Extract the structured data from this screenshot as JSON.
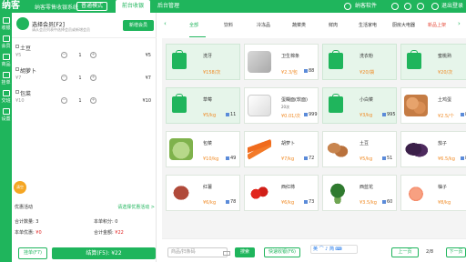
{
  "header": {
    "brand": "纳客",
    "slogan": "纳客零售收银系统",
    "mode_label": "普通模式",
    "tabs": [
      "前台收银",
      "后台管理"
    ],
    "software_name": "纳客软件",
    "logout_label": "退出登录"
  },
  "sidebar": [
    "收银",
    "会员",
    "商品",
    "挂单",
    "交班",
    "设置"
  ],
  "member": {
    "title": "选择会员[F2]",
    "hint": "请从会员列表中选择会员或新增会员",
    "new_member_label": "新增会员"
  },
  "cart": [
    {
      "name": "土豆",
      "price": "¥5",
      "qty": "1",
      "subtotal": "¥5"
    },
    {
      "name": "胡萝卜",
      "price": "¥7",
      "qty": "1",
      "subtotal": "¥7"
    },
    {
      "name": "包菜",
      "price": "¥10",
      "qty": "1",
      "subtotal": "¥10"
    }
  ],
  "bubble_label": "清空",
  "promo": {
    "label": "优惠活动",
    "link": "请选择优惠活动 >"
  },
  "summary": {
    "count_label": "合计数量:",
    "count": "3",
    "points_label": "本单积分:",
    "points": "0",
    "discount_label": "本单优惠:",
    "discount": "¥0",
    "total_label": "合计金额:",
    "total": "¥22"
  },
  "actions": {
    "hold_label": "挂单(F7)",
    "pay_label": "结算(F5): ¥22"
  },
  "categories": [
    "全部",
    "饮料",
    "冷冻品",
    "蔬菜类",
    "鲜肉",
    "生活家电",
    "厨房大电器",
    "新品上架"
  ],
  "products": [
    {
      "name": "洗牙",
      "price": "¥158/次",
      "stock": "",
      "style": "green",
      "img": "bag"
    },
    {
      "name": "卫生棉条",
      "price": "¥2.3/包",
      "stock": "88",
      "style": "white",
      "img": "box"
    },
    {
      "name": "洗衣粉",
      "price": "¥20/袋",
      "stock": "",
      "style": "green",
      "img": "bag"
    },
    {
      "name": "蜜桃熟",
      "price": "¥20/次",
      "stock": "",
      "style": "green",
      "img": "bag"
    },
    {
      "name": "草莓",
      "price": "¥5/kg",
      "stock": "11",
      "style": "green",
      "img": "bag"
    },
    {
      "name": "蛋糊面(软面)",
      "sub": "20次",
      "price": "¥0.01/次",
      "stock": "999",
      "style": "white",
      "img": "card"
    },
    {
      "name": "小白菜",
      "price": "¥3/kg",
      "stock": "995",
      "style": "green",
      "img": "bag"
    },
    {
      "name": "土鸡蛋",
      "price": "¥2.5/个",
      "stock": "8",
      "style": "white",
      "img": "eggs"
    },
    {
      "name": "包菜",
      "price": "¥10/kg",
      "stock": "49",
      "style": "white",
      "img": "cabbage"
    },
    {
      "name": "胡萝卜",
      "price": "¥7/kg",
      "stock": "72",
      "style": "white",
      "img": "carrot"
    },
    {
      "name": "土豆",
      "price": "¥5/kg",
      "stock": "51",
      "style": "white",
      "img": "potato"
    },
    {
      "name": "茄子",
      "price": "¥6.5/kg",
      "stock": "8",
      "style": "white",
      "img": "eggplant"
    },
    {
      "name": "红薯",
      "price": "¥6/kg",
      "stock": "78",
      "style": "white",
      "img": "sweetpotato"
    },
    {
      "name": "西红柿",
      "price": "¥6/kg",
      "stock": "73",
      "style": "white",
      "img": "tomato"
    },
    {
      "name": "西蓝花",
      "price": "¥3.5/kg",
      "stock": "60",
      "style": "white",
      "img": "broccoli"
    },
    {
      "name": "柚子",
      "price": "¥8/kg",
      "stock": "",
      "style": "white",
      "img": "grapefruit"
    }
  ],
  "bottom": {
    "search_placeholder": "商品/扫条码",
    "search_button": "搜索",
    "quick_label": "快速收银(F6)",
    "ime": "英 ⌒ ♪ 简 ⌨",
    "prev": "上一页",
    "page": "2/8",
    "next": "下一页"
  },
  "colors": {
    "brand_green": "#1fb55c",
    "price_orange": "#f08a24",
    "danger_red": "#e02020"
  }
}
